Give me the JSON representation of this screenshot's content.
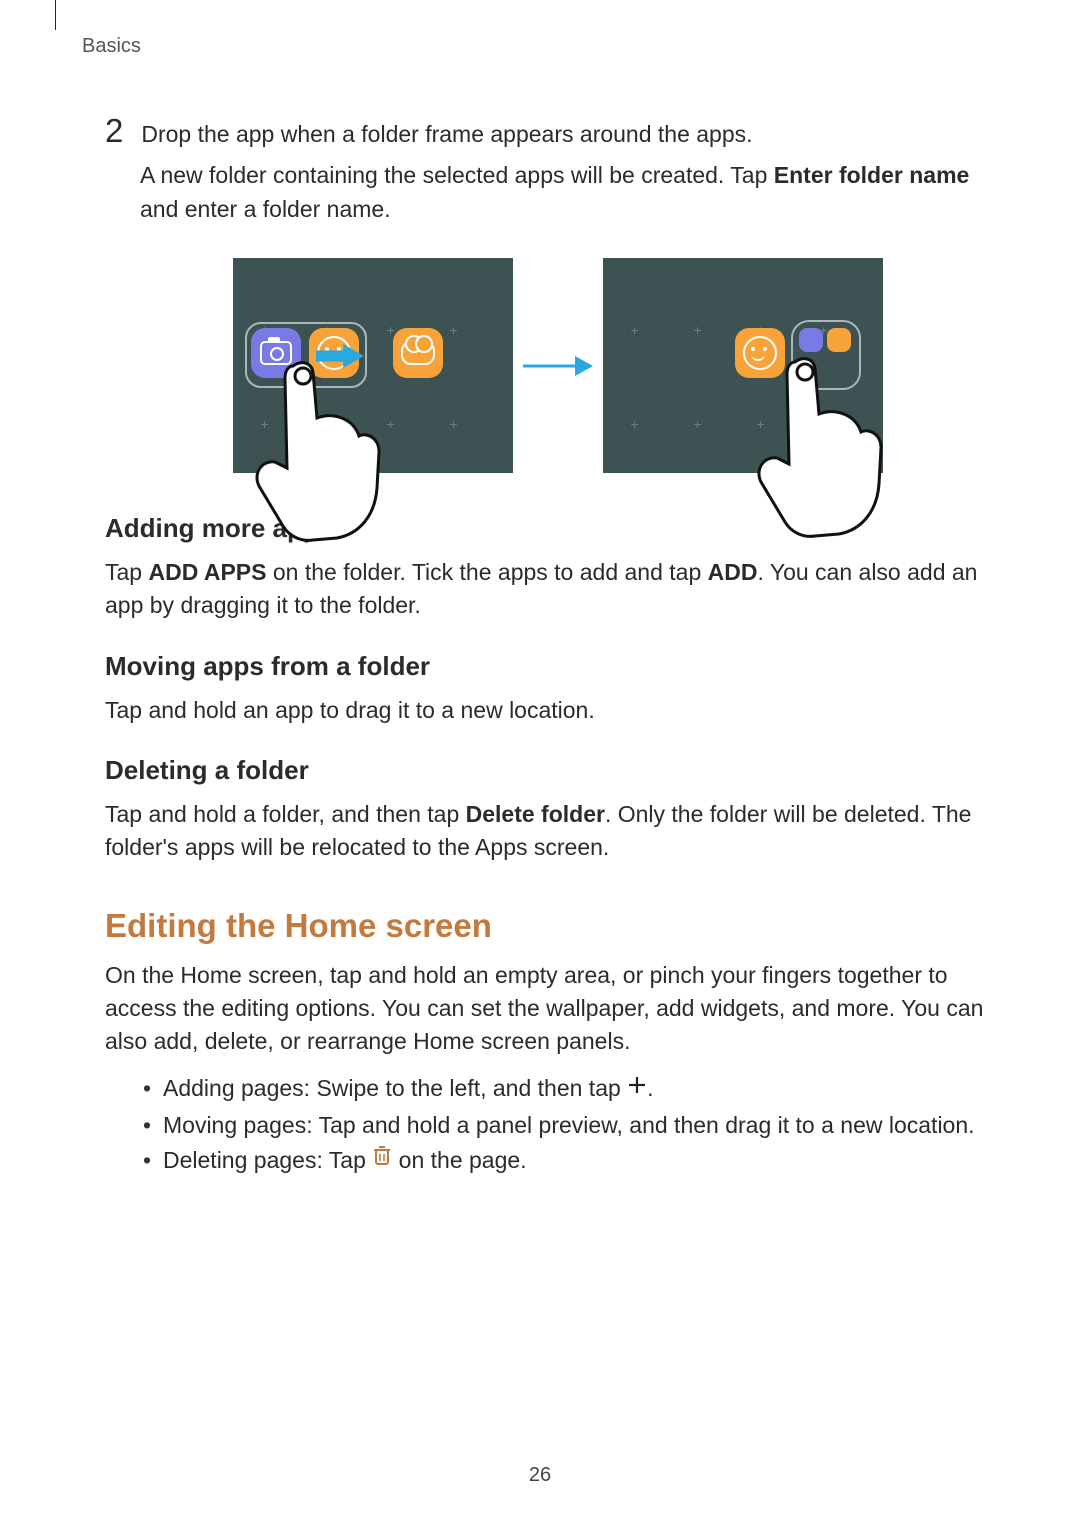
{
  "header": {
    "breadcrumb": "Basics"
  },
  "step": {
    "number": "2",
    "line1": "Drop the app when a folder frame appears around the apps.",
    "line2a": "A new folder containing the selected apps will be created. Tap ",
    "line2b": "Enter folder name",
    "line2c": " and enter a folder name."
  },
  "sections": {
    "adding_apps": {
      "title": "Adding more apps",
      "p1a": "Tap ",
      "p1b": "ADD APPS",
      "p1c": " on the folder. Tick the apps to add and tap ",
      "p1d": "ADD",
      "p1e": ". You can also add an app by dragging it to the folder."
    },
    "moving_apps": {
      "title": "Moving apps from a folder",
      "p1": "Tap and hold an app to drag it to a new location."
    },
    "deleting_folder": {
      "title": "Deleting a folder",
      "p1a": "Tap and hold a folder, and then tap ",
      "p1b": "Delete folder",
      "p1c": ". Only the folder will be deleted. The folder's apps will be relocated to the Apps screen."
    },
    "editing_home": {
      "title": "Editing the Home screen",
      "intro": "On the Home screen, tap and hold an empty area, or pinch your fingers together to access the editing options. You can set the wallpaper, add widgets, and more. You can also add, delete, or rearrange Home screen panels.",
      "b1a": "Adding pages: Swipe to the left, and then tap ",
      "b1b": ".",
      "b2": "Moving pages: Tap and hold a panel preview, and then drag it to a new location.",
      "b3a": "Deleting pages: Tap ",
      "b3b": " on the page."
    }
  },
  "page_number": "26"
}
